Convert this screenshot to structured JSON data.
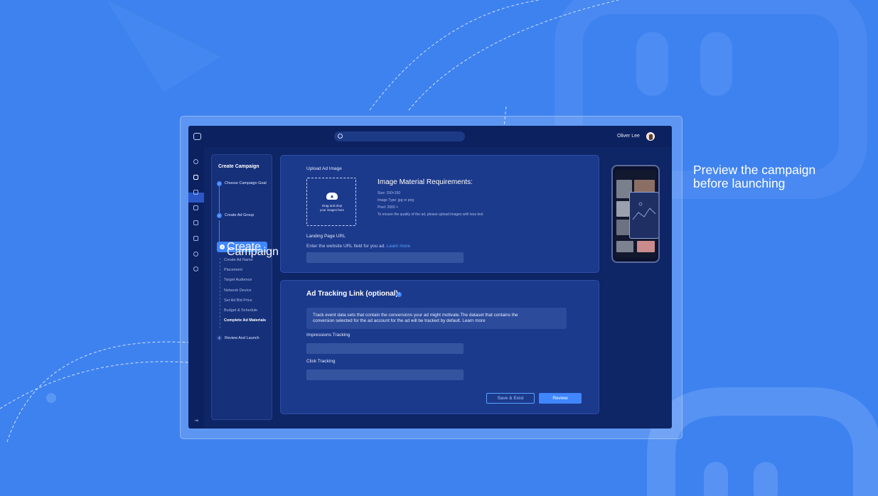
{
  "marketing": {
    "headline_line1": "Preview the campaign",
    "headline_line2": "before launching"
  },
  "topbar": {
    "user_name": "Oliver Lee"
  },
  "steps": {
    "title": "Create Campaign",
    "items": [
      {
        "num": "",
        "label": "Choose Campaign Goal",
        "state": "done"
      },
      {
        "num": "",
        "label": "Create Ad Group",
        "state": "done"
      },
      {
        "num": "3",
        "label": "Create Campaign",
        "state": "active"
      },
      {
        "num": "4",
        "label": "Review And Launch",
        "state": "pending"
      }
    ],
    "substeps": [
      "Create Ad Name",
      "Placement",
      "Target Audience",
      "Network Device",
      "Set Ad Bid Price",
      "Budget & Schedule",
      "Complete Ad Materials"
    ]
  },
  "upload": {
    "label": "Upload Ad Image",
    "drop_line1": "Drag and drop",
    "drop_line2": "your images here",
    "req_title": "Image Material Requirements:",
    "req_size": "Size: 150×150",
    "req_type": "Image Type: jpg or png",
    "req_pixel": "Pixel: 2000 +",
    "req_note": "To ensure the quality of the ad, please upload images with less text",
    "landing_label": "Landing Page URL",
    "landing_hint": "Enter the website URL field for you ad.",
    "landing_link": "Learn more"
  },
  "tracking": {
    "title": "Ad Tracking Link (optional)",
    "info_glyph": "i",
    "description_line1": "Track event data sets that contain the conversions your ad might motivate.The dataset that contains the",
    "description_line2": "conversion selected for the ad account for the ad will be tracked by default. Learn more",
    "impressions_label": "Impressions Tracking",
    "click_label": "Click Tracking",
    "save_exist": "Save & Exist",
    "review": "Review"
  },
  "colors": {
    "background": "#3e82f0",
    "app_bg": "#0e2566",
    "accent": "#3f86ff"
  }
}
